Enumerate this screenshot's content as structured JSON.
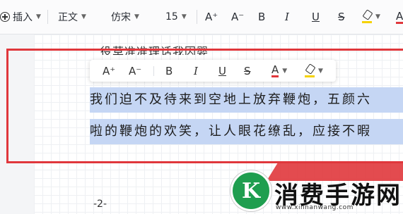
{
  "toolbar": {
    "insert_label": "插入",
    "style_value": "正文",
    "font_value": "仿宋",
    "size_value": "15",
    "grow_label": "A⁺",
    "shrink_label": "A⁻",
    "bold_label": "B",
    "italic_label": "I",
    "underline_label": "U",
    "strike_label": "S",
    "edge_label": "A"
  },
  "floating": {
    "grow_label": "A⁺",
    "shrink_label": "A⁻",
    "bold_label": "B",
    "italic_label": "I",
    "underline_label": "U",
    "strike_label": "S",
    "color_label": "A"
  },
  "document": {
    "cut_line": "役草准准理话我因婴",
    "line1": "我们迫不及待来到空地上放弃鞭炮，五颜六",
    "line2": "啦的鞭炮的欢笑，让人眼花缭乱，应接不暇",
    "page_number": "-2-"
  },
  "watermark": {
    "brand": "消费手游网",
    "url": "www.xinnanwang.com"
  },
  "colors": {
    "highlight": "#c5d6f4",
    "red_box": "#e0373c",
    "font_color_bar": "#e0373c",
    "highlight_bar": "#f5d200"
  }
}
